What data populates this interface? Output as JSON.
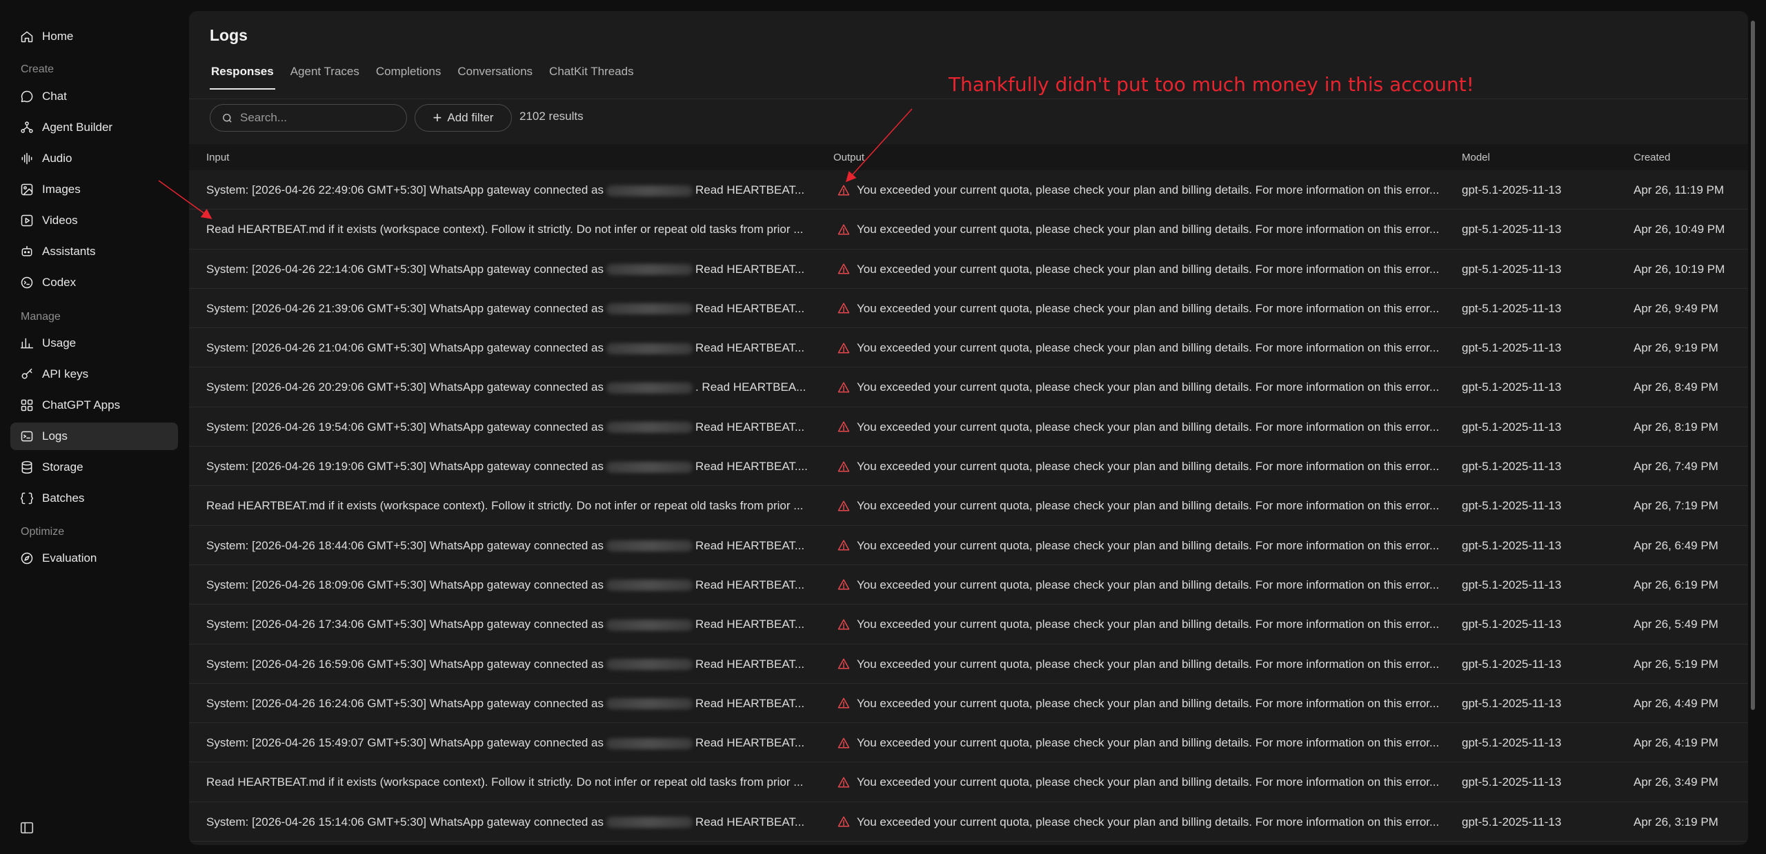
{
  "sidebar": {
    "home": "Home",
    "section_create": "Create",
    "create_items": [
      "Chat",
      "Agent Builder",
      "Audio",
      "Images",
      "Videos",
      "Assistants",
      "Codex"
    ],
    "section_manage": "Manage",
    "manage_items": [
      "Usage",
      "API keys",
      "ChatGPT Apps",
      "Logs",
      "Storage",
      "Batches"
    ],
    "section_optimize": "Optimize",
    "optimize_items": [
      "Evaluation"
    ],
    "active_item": "Logs"
  },
  "page": {
    "title": "Logs",
    "tabs": [
      "Responses",
      "Agent Traces",
      "Completions",
      "Conversations",
      "ChatKit Threads"
    ],
    "active_tab": "Responses",
    "search_placeholder": "Search...",
    "add_filter_label": "Add filter",
    "results_count": "2102 results"
  },
  "annotation": "Thankfully didn't put too much money in this account!",
  "table": {
    "columns": [
      "Input",
      "Output",
      "Model",
      "Created"
    ],
    "output_text": "You exceeded your current quota, please check your plan and billing details. For more information on this error...",
    "rows": [
      {
        "input_pre": "System: [2026-04-26 22:49:06 GMT+5:30] WhatsApp gateway connected as",
        "input_post": "Read HEARTBEAT...",
        "model": "gpt-5.1-2025-11-13",
        "created": "Apr 26, 11:19 PM"
      },
      {
        "input_pre": "Read HEARTBEAT.md if it exists (workspace context). Follow it strictly. Do not infer or repeat old tasks from prior ...",
        "input_post": "",
        "model": "gpt-5.1-2025-11-13",
        "created": "Apr 26, 10:49 PM"
      },
      {
        "input_pre": "System: [2026-04-26 22:14:06 GMT+5:30] WhatsApp gateway connected as",
        "input_post": "Read HEARTBEAT...",
        "model": "gpt-5.1-2025-11-13",
        "created": "Apr 26, 10:19 PM"
      },
      {
        "input_pre": "System: [2026-04-26 21:39:06 GMT+5:30] WhatsApp gateway connected as",
        "input_post": "Read HEARTBEAT...",
        "model": "gpt-5.1-2025-11-13",
        "created": "Apr 26, 9:49 PM"
      },
      {
        "input_pre": "System: [2026-04-26 21:04:06 GMT+5:30] WhatsApp gateway connected as",
        "input_post": "Read HEARTBEAT...",
        "model": "gpt-5.1-2025-11-13",
        "created": "Apr 26, 9:19 PM"
      },
      {
        "input_pre": "System: [2026-04-26 20:29:06 GMT+5:30] WhatsApp gateway connected as",
        "input_post": ". Read HEARTBEA...",
        "model": "gpt-5.1-2025-11-13",
        "created": "Apr 26, 8:49 PM"
      },
      {
        "input_pre": "System: [2026-04-26 19:54:06 GMT+5:30] WhatsApp gateway connected as",
        "input_post": "Read HEARTBEAT...",
        "model": "gpt-5.1-2025-11-13",
        "created": "Apr 26, 8:19 PM"
      },
      {
        "input_pre": "System: [2026-04-26 19:19:06 GMT+5:30] WhatsApp gateway connected as",
        "input_post": "Read HEARTBEAT....",
        "model": "gpt-5.1-2025-11-13",
        "created": "Apr 26, 7:49 PM"
      },
      {
        "input_pre": "Read HEARTBEAT.md if it exists (workspace context). Follow it strictly. Do not infer or repeat old tasks from prior ...",
        "input_post": "",
        "model": "gpt-5.1-2025-11-13",
        "created": "Apr 26, 7:19 PM"
      },
      {
        "input_pre": "System: [2026-04-26 18:44:06 GMT+5:30] WhatsApp gateway connected as",
        "input_post": "Read HEARTBEAT...",
        "model": "gpt-5.1-2025-11-13",
        "created": "Apr 26, 6:49 PM"
      },
      {
        "input_pre": "System: [2026-04-26 18:09:06 GMT+5:30] WhatsApp gateway connected as",
        "input_post": "Read HEARTBEAT...",
        "model": "gpt-5.1-2025-11-13",
        "created": "Apr 26, 6:19 PM"
      },
      {
        "input_pre": "System: [2026-04-26 17:34:06 GMT+5:30] WhatsApp gateway connected as",
        "input_post": "Read HEARTBEAT...",
        "model": "gpt-5.1-2025-11-13",
        "created": "Apr 26, 5:49 PM"
      },
      {
        "input_pre": "System: [2026-04-26 16:59:06 GMT+5:30] WhatsApp gateway connected as",
        "input_post": "Read HEARTBEAT...",
        "model": "gpt-5.1-2025-11-13",
        "created": "Apr 26, 5:19 PM"
      },
      {
        "input_pre": "System: [2026-04-26 16:24:06 GMT+5:30] WhatsApp gateway connected as",
        "input_post": "Read HEARTBEAT...",
        "model": "gpt-5.1-2025-11-13",
        "created": "Apr 26, 4:49 PM"
      },
      {
        "input_pre": "System: [2026-04-26 15:49:07 GMT+5:30] WhatsApp gateway connected as",
        "input_post": "Read HEARTBEAT...",
        "model": "gpt-5.1-2025-11-13",
        "created": "Apr 26, 4:19 PM"
      },
      {
        "input_pre": "Read HEARTBEAT.md if it exists (workspace context). Follow it strictly. Do not infer or repeat old tasks from prior ...",
        "input_post": "",
        "model": "gpt-5.1-2025-11-13",
        "created": "Apr 26, 3:49 PM"
      },
      {
        "input_pre": "System: [2026-04-26 15:14:06 GMT+5:30] WhatsApp gateway connected as",
        "input_post": "Read HEARTBEAT...",
        "model": "gpt-5.1-2025-11-13",
        "created": "Apr 26, 3:19 PM"
      }
    ]
  },
  "colors": {
    "annotation": "#e8242f",
    "warning": "#e5484d",
    "background": "#0f0f0f",
    "panel": "#1c1c1c"
  }
}
